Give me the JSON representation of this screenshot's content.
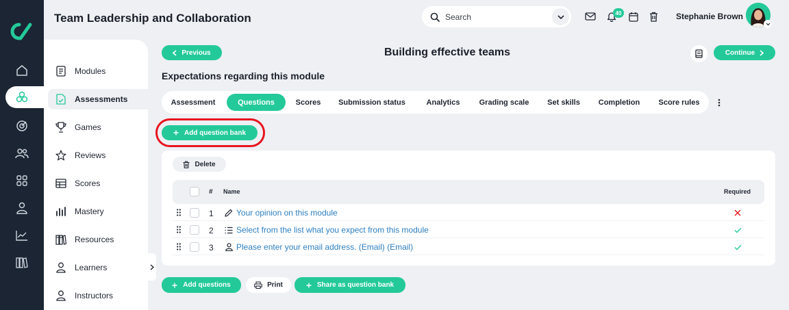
{
  "header": {
    "title": "Team Leadership and Collaboration",
    "search_placeholder": "Search",
    "notification_count": "40",
    "user_name": "Stephanie Brown"
  },
  "rail": {
    "icons": [
      "logo-icon",
      "home-icon",
      "assessments-icon",
      "target-icon",
      "users-icon",
      "grid-icon",
      "user-icon",
      "chart-icon",
      "library-icon"
    ],
    "active": "assessments-icon"
  },
  "subnav": {
    "items": [
      {
        "label": "Modules",
        "icon": "document-list-icon"
      },
      {
        "label": "Assessments",
        "icon": "file-check-icon",
        "active": true
      },
      {
        "label": "Games",
        "icon": "trophy-icon"
      },
      {
        "label": "Reviews",
        "icon": "star-icon"
      },
      {
        "label": "Scores",
        "icon": "table-icon"
      },
      {
        "label": "Mastery",
        "icon": "bar-chart-icon"
      },
      {
        "label": "Resources",
        "icon": "books-icon"
      },
      {
        "label": "Learners",
        "icon": "user-icon"
      },
      {
        "label": "Instructors",
        "icon": "instructor-icon"
      }
    ]
  },
  "page": {
    "previous_label": "Previous",
    "title": "Building effective teams",
    "continue_label": "Continue",
    "section_title": "Expectations regarding this module"
  },
  "tabs": [
    {
      "label": "Assessment"
    },
    {
      "label": "Questions",
      "active": true
    },
    {
      "label": "Scores"
    },
    {
      "label": "Submission status"
    },
    {
      "label": "Analytics"
    },
    {
      "label": "Grading scale"
    },
    {
      "label": "Set skills"
    },
    {
      "label": "Completion"
    },
    {
      "label": "Score rules"
    }
  ],
  "actions": {
    "add_question_bank": "Add question bank",
    "delete": "Delete",
    "add_questions": "Add questions",
    "print": "Print",
    "share_as_question_bank": "Share as question bank"
  },
  "table": {
    "columns": {
      "number": "#",
      "name": "Name",
      "required": "Required"
    },
    "rows": [
      {
        "number": "1",
        "type_icon": "pencil-icon",
        "name": "Your opinion on this module",
        "required": false
      },
      {
        "number": "2",
        "type_icon": "list-icon",
        "name": "Select from the list what you expect from this module",
        "required": true
      },
      {
        "number": "3",
        "type_icon": "person-icon",
        "name": "Please enter your email address. (Email) (Email)",
        "required": true
      }
    ]
  },
  "colors": {
    "accent": "#24c99a",
    "rail": "#1b2533",
    "link": "#2e7fc0",
    "danger": "#e8141f",
    "background": "#eef0f4"
  }
}
